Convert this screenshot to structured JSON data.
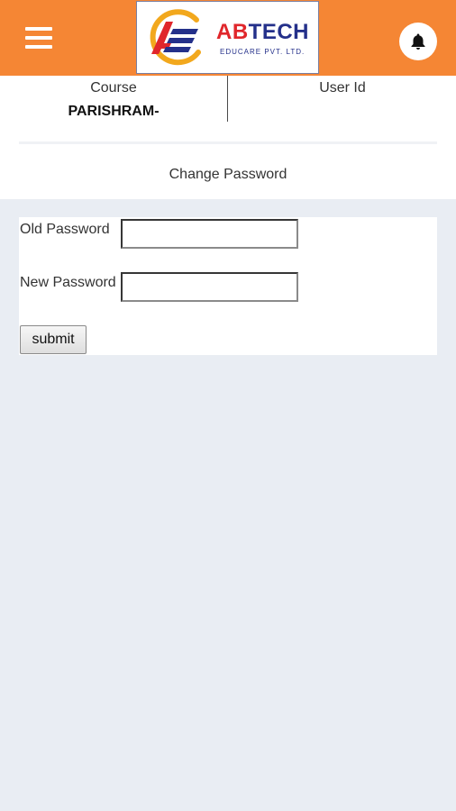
{
  "header": {
    "menu_icon": "hamburger-menu-icon",
    "logo": {
      "brand_prefix": "AB",
      "brand_main": "TECH",
      "tagline": "EDUCARE PVT. LTD.",
      "colors": {
        "red": "#e0262b",
        "navy": "#24308a",
        "gold": "#f2a81d"
      }
    },
    "notification_icon": "bell-icon",
    "background_color": "#f58634"
  },
  "profile": {
    "course_label": "Course",
    "course_value": "PARISHRAM-",
    "user_id_label": "User Id",
    "user_id_value": ""
  },
  "section": {
    "title": "Change Password"
  },
  "form": {
    "old_password_label": "Old Password",
    "old_password_value": "",
    "new_password_label": "New Password",
    "new_password_value": "",
    "submit_label": "submit"
  }
}
